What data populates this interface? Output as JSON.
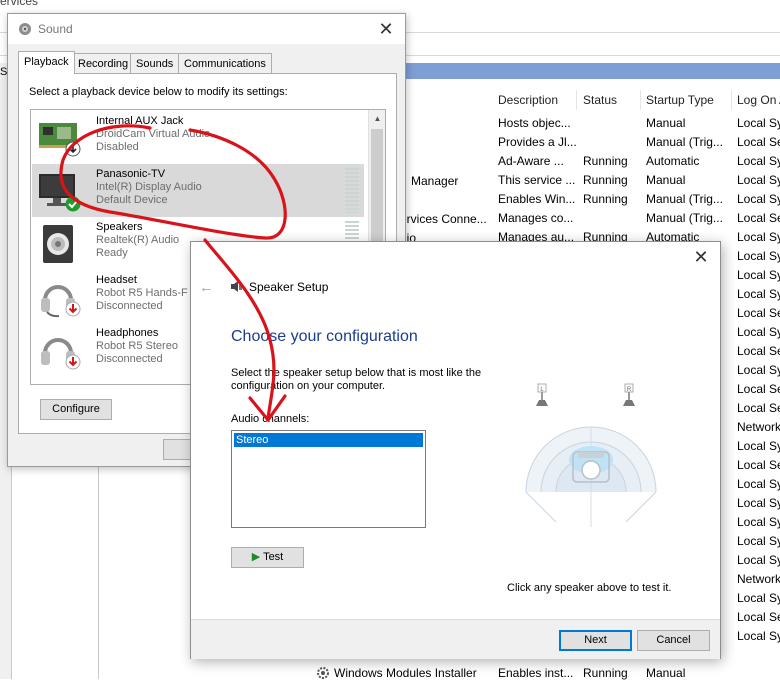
{
  "background_window": {
    "title": "ervices",
    "left_label": "S",
    "columns": [
      "Description",
      "Status",
      "Startup Type",
      "Log On A"
    ],
    "partial_names": [
      "Manager",
      "ervices Conne...",
      "dio"
    ],
    "rows": [
      {
        "description": "Hosts objec...",
        "status": "",
        "startup": "Manual",
        "logon": "Local Sy"
      },
      {
        "description": "Provides a Jl...",
        "status": "",
        "startup": "Manual (Trig...",
        "logon": "Local Se"
      },
      {
        "description": "Ad-Aware ...",
        "status": "Running",
        "startup": "Automatic",
        "logon": "Local Sy"
      },
      {
        "description": "This service ...",
        "status": "Running",
        "startup": "Manual",
        "logon": "Local Sy"
      },
      {
        "description": "Enables Win...",
        "status": "Running",
        "startup": "Manual (Trig...",
        "logon": "Local Sy"
      },
      {
        "description": "Manages co...",
        "status": "",
        "startup": "Manual (Trig...",
        "logon": "Local Se"
      },
      {
        "description": "Manages au...",
        "status": "Running",
        "startup": "Automatic",
        "logon": "Local Sy"
      }
    ],
    "logon_column_rest": [
      "Local Sy",
      "Local Sy",
      "Local Sy",
      "Local Se",
      "Local Sy",
      "Local Se",
      "Local Sy",
      "Local Se",
      "Local Se",
      "Network",
      "Local Sy",
      "Local Se",
      "Local Sy",
      "Local Sy",
      "Local Sy",
      "Local Sy",
      "Local Sy",
      "Network",
      "Local Sy",
      "Local Se",
      "Local Sy"
    ],
    "last_row": {
      "name": "Windows Modules Installer",
      "description": "Enables inst...",
      "status": "Running",
      "startup": "Manual"
    }
  },
  "sound_dialog": {
    "title": "Sound",
    "close_label": "✕",
    "tabs": [
      "Playback",
      "Recording",
      "Sounds",
      "Communications"
    ],
    "instruction": "Select a playback device below to modify its settings:",
    "devices": [
      {
        "name": "Internal AUX Jack",
        "line2": "DroidCam Virtual Audio",
        "line3": "Disabled",
        "icon": "sound-card-icon"
      },
      {
        "name": "Panasonic-TV",
        "line2": "Intel(R) Display Audio",
        "line3": "Default Device",
        "icon": "tv-monitor-icon"
      },
      {
        "name": "Speakers",
        "line2": "Realtek(R) Audio",
        "line3": "Ready",
        "icon": "speaker-icon"
      },
      {
        "name": "Headset",
        "line2": "Robot  R5 Hands-F",
        "line3": "Disconnected",
        "icon": "headset-icon"
      },
      {
        "name": "Headphones",
        "line2": "Robot  R5 Stereo",
        "line3": "Disconnected",
        "icon": "headphones-icon"
      }
    ],
    "configure_label": "Configure"
  },
  "speaker_setup": {
    "title": "Speaker Setup",
    "close_label": "✕",
    "back_label": "←",
    "heading": "Choose your configuration",
    "instruction": "Select the speaker setup below that is most like the configuration on your computer.",
    "channels_label": "Audio channels:",
    "selected_channel": "Stereo",
    "test_label": "Test",
    "test_glyph": "▶",
    "speaker_left_label": "L",
    "speaker_right_label": "R",
    "hint": "Click any speaker above to test it.",
    "next_label": "Next",
    "cancel_label": "Cancel"
  },
  "colors": {
    "selection": "#0078d7",
    "heading": "#1a3e8c",
    "annotation": "#d8141a"
  }
}
